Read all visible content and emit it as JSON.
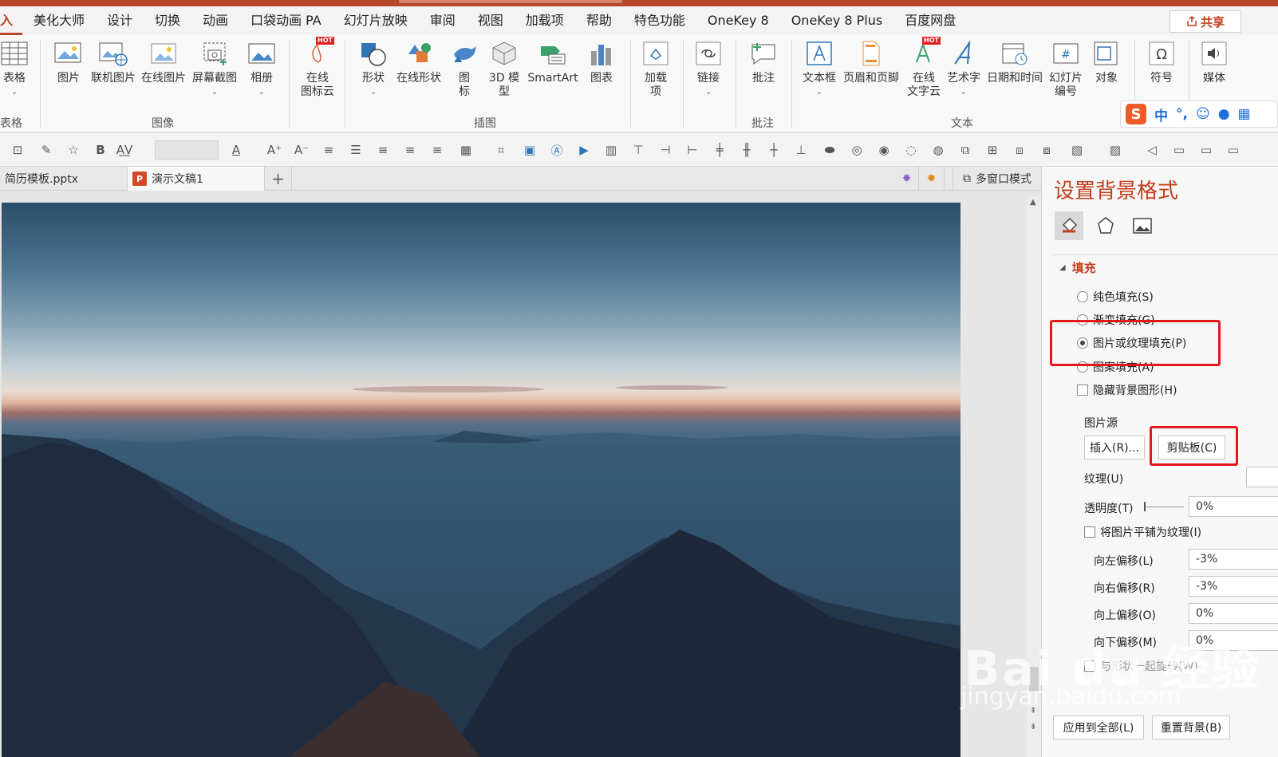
{
  "tabs": [
    "入",
    "美化大师",
    "设计",
    "切换",
    "动画",
    "口袋动画 PA",
    "幻灯片放映",
    "审阅",
    "视图",
    "加载项",
    "帮助",
    "特色功能",
    "OneKey 8",
    "OneKey 8 Plus",
    "百度网盘"
  ],
  "share_label": "共享",
  "ribbon": {
    "table": "表格",
    "table_group": "表格",
    "image_buttons": [
      "图片",
      "联机图片",
      "在线图片",
      "屏幕截图",
      "相册"
    ],
    "image_group": "图像",
    "icon_cloud": "在线\n图标云",
    "illus_buttons": [
      "形状",
      "在线形状",
      "图\n标",
      "3D 模\n型",
      "SmartArt",
      "图表"
    ],
    "illus_group": "插图",
    "addin": "加载\n项",
    "link": "链接",
    "comment": "批注",
    "comment_group": "批注",
    "text_buttons": [
      "文本框",
      "页眉和页脚",
      "在线\n文字云",
      "艺术字",
      "日期和时间",
      "幻灯片\n编号",
      "对象"
    ],
    "text_group": "文本",
    "symbol": "符号",
    "media": "媒体",
    "hot": "HOT"
  },
  "ime": {
    "s": "S",
    "mode": "中"
  },
  "doc_tabs": [
    "简历模板.pptx",
    "演示文稿1"
  ],
  "doc_add": "+",
  "multi_window": "多窗口模式",
  "pane": {
    "title": "设置背景格式",
    "fill_section": "填充",
    "opt_solid": "纯色填充(S)",
    "opt_gradient": "渐变填充(G)",
    "opt_picture": "图片或纹理填充(P)",
    "opt_pattern": "图案填充(A)",
    "opt_hide": "隐藏背景图形(H)",
    "picture_source": "图片源",
    "insert_btn": "插入(R)...",
    "clipboard_btn": "剪贴板(C)",
    "texture": "纹理(U)",
    "transparency": "透明度(T)",
    "transparency_val": "0%",
    "tile": "将图片平铺为纹理(I)",
    "offset_left": "向左偏移(L)",
    "offset_left_val": "-3%",
    "offset_right": "向右偏移(R)",
    "offset_right_val": "-3%",
    "offset_up": "向上偏移(O)",
    "offset_up_val": "0%",
    "offset_down": "向下偏移(M)",
    "offset_down_val": "0%",
    "rotate_with": "与形状一起旋转(W)",
    "apply_all": "应用到全部(L)",
    "reset_bg": "重置背景(B)"
  },
  "watermark": {
    "brand": "Bai du 经验",
    "url": "jingyan.baidu.com"
  },
  "colors": {
    "accent": "#b7472a",
    "pane_title": "#c43e1c",
    "highlight": "#e0181b"
  }
}
